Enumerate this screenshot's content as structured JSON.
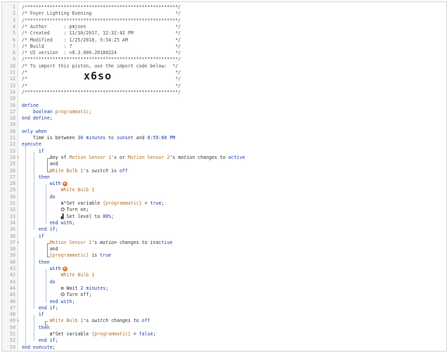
{
  "editor": {
    "import_code": "x6so",
    "lines": [
      {
        "n": "1",
        "t": [
          [
            "/*******************************************************/",
            "cm"
          ]
        ]
      },
      {
        "n": "2",
        "t": [
          [
            "/* Foyer Lighting Evening                              */",
            "cm"
          ]
        ]
      },
      {
        "n": "3",
        "t": [
          [
            "/*******************************************************/",
            "cm"
          ]
        ]
      },
      {
        "n": "4",
        "t": [
          [
            "/* Author      : pmjoen                                */",
            "cm"
          ]
        ]
      },
      {
        "n": "5",
        "t": [
          [
            "/* Created     : 11/30/2017, 12:32:42 PM               */",
            "cm"
          ]
        ]
      },
      {
        "n": "6",
        "t": [
          [
            "/* Modified    : 1/25/2018, 9:54:25 AM                 */",
            "cm"
          ]
        ]
      },
      {
        "n": "7",
        "t": [
          [
            "/* Build       : 7                                     */",
            "cm"
          ]
        ]
      },
      {
        "n": "8",
        "t": [
          [
            "/* UI version  : v0.3.000.20180224                     */",
            "cm"
          ]
        ]
      },
      {
        "n": "9",
        "t": [
          [
            "/*******************************************************/",
            "cm"
          ]
        ]
      },
      {
        "n": "10",
        "t": [
          [
            "/* To import this piston, use the import code below:  */",
            "cm"
          ]
        ]
      },
      {
        "n": "11",
        "t": [
          [
            "/*                                                     */",
            "cm"
          ]
        ]
      },
      {
        "n": "12",
        "t": [
          [
            "/*                                                     */",
            "cm"
          ]
        ]
      },
      {
        "n": "13",
        "t": [
          [
            "/*                                                     */",
            "cm"
          ]
        ]
      },
      {
        "n": "14",
        "t": [
          [
            "/*******************************************************/",
            "cm"
          ]
        ]
      },
      {
        "n": "15",
        "t": []
      },
      {
        "n": "16",
        "t": [
          [
            "define",
            "kw"
          ]
        ]
      },
      {
        "n": "17",
        "t": [
          [
            "    boolean ",
            "kw"
          ],
          [
            "programmatic",
            "var"
          ],
          [
            ";",
            ""
          ]
        ]
      },
      {
        "n": "18",
        "t": [
          [
            "end define;",
            "kw"
          ]
        ]
      },
      {
        "n": "19",
        "t": []
      },
      {
        "n": "20",
        "t": [
          [
            "only when",
            "kw"
          ]
        ]
      },
      {
        "n": "21",
        "t": [
          [
            "    Time is between ",
            ""
          ],
          [
            "30 minutes",
            "num"
          ],
          [
            " to ",
            ""
          ],
          [
            "sunset",
            "kw"
          ],
          [
            " and ",
            ""
          ],
          [
            "8:59:00 PM",
            "num"
          ]
        ]
      },
      {
        "n": "22",
        "t": [
          [
            "execute",
            "kw"
          ]
        ]
      },
      {
        "n": "23",
        "t": [
          [
            "      if",
            "kw"
          ]
        ]
      },
      {
        "n": "24",
        "t": [
          [
            "          Any of ",
            ""
          ],
          [
            "Motion Sensor 1",
            "dev"
          ],
          [
            "'s or ",
            ""
          ],
          [
            "Motion Sensor 2",
            "dev"
          ],
          [
            "'s ",
            ""
          ],
          [
            "motion",
            "it"
          ],
          [
            " changes to ",
            ""
          ],
          [
            "active",
            "kw"
          ]
        ]
      },
      {
        "n": "25",
        "t": [
          [
            "          and",
            ""
          ]
        ]
      },
      {
        "n": "26",
        "t": [
          [
            "          ",
            "",
            ""
          ],
          [
            "White Bulb 1",
            "dev"
          ],
          [
            "'s ",
            ""
          ],
          [
            "switch",
            "it"
          ],
          [
            " is ",
            ""
          ],
          [
            "off",
            "kw"
          ]
        ]
      },
      {
        "n": "27",
        "t": [
          [
            "      then",
            "kw"
          ]
        ]
      },
      {
        "n": "28",
        "t": [
          [
            "          with",
            "kw"
          ]
        ]
      },
      {
        "n": "29",
        "t": [
          [
            "              ",
            "",
            ""
          ],
          [
            "White Bulb 1",
            "dev"
          ]
        ]
      },
      {
        "n": "30",
        "t": [
          [
            "          do",
            "kw"
          ]
        ]
      },
      {
        "n": "31",
        "t": [
          [
            "              ",
            "",
            ""
          ],
          [
            "x² ",
            "ic"
          ],
          [
            "Set variable ",
            ""
          ],
          [
            "{programmatic}",
            "var"
          ],
          [
            " = ",
            ""
          ],
          [
            "true",
            "bool"
          ],
          [
            ";",
            ""
          ]
        ]
      },
      {
        "n": "32",
        "t": [
          [
            "              ",
            "",
            ""
          ],
          [
            "⏻ ",
            "ic"
          ],
          [
            "Turn on;",
            ""
          ]
        ]
      },
      {
        "n": "33",
        "t": [
          [
            "              ",
            "",
            ""
          ],
          [
            "▟ ",
            "ic"
          ],
          [
            "Set level to ",
            ""
          ],
          [
            "80%",
            "num"
          ],
          [
            ";",
            ""
          ]
        ]
      },
      {
        "n": "34",
        "t": [
          [
            "          end with;",
            "kw"
          ]
        ]
      },
      {
        "n": "35",
        "t": [
          [
            "      end if;",
            "kw"
          ]
        ]
      },
      {
        "n": "36",
        "t": [
          [
            "      if",
            "kw"
          ]
        ]
      },
      {
        "n": "37",
        "t": [
          [
            "          ",
            "",
            ""
          ],
          [
            "Motion Sensor 1",
            "dev"
          ],
          [
            "'s ",
            ""
          ],
          [
            "motion",
            "it"
          ],
          [
            " changes to ",
            ""
          ],
          [
            "inactive",
            "kw"
          ]
        ]
      },
      {
        "n": "38",
        "t": [
          [
            "          and",
            ""
          ]
        ]
      },
      {
        "n": "39",
        "t": [
          [
            "          ",
            "",
            ""
          ],
          [
            "{programmatic}",
            "var"
          ],
          [
            " is ",
            ""
          ],
          [
            "true",
            "bool"
          ]
        ]
      },
      {
        "n": "40",
        "t": [
          [
            "      then",
            "kw"
          ]
        ]
      },
      {
        "n": "41",
        "t": [
          [
            "          with",
            "kw"
          ]
        ]
      },
      {
        "n": "42",
        "t": [
          [
            "              ",
            "",
            ""
          ],
          [
            "White Bulb 1",
            "dev"
          ]
        ]
      },
      {
        "n": "43",
        "t": [
          [
            "          do",
            "kw"
          ]
        ]
      },
      {
        "n": "44",
        "t": [
          [
            "              ",
            "",
            ""
          ],
          [
            "⊙ ",
            "ic"
          ],
          [
            "Wait ",
            ""
          ],
          [
            "2 minutes",
            "num"
          ],
          [
            ";",
            ""
          ]
        ]
      },
      {
        "n": "45",
        "t": [
          [
            "              ",
            "",
            ""
          ],
          [
            "⏻ ",
            "ic"
          ],
          [
            "Turn off;",
            ""
          ]
        ]
      },
      {
        "n": "46",
        "t": [
          [
            "          end with;",
            "kw"
          ]
        ]
      },
      {
        "n": "47",
        "t": [
          [
            "      end if;",
            "kw"
          ]
        ]
      },
      {
        "n": "48",
        "t": [
          [
            "      if",
            "kw"
          ]
        ]
      },
      {
        "n": "49",
        "t": [
          [
            "          ",
            "",
            ""
          ],
          [
            "White Bulb 1",
            "dev"
          ],
          [
            "'s ",
            ""
          ],
          [
            "switch",
            "it"
          ],
          [
            " changes to ",
            ""
          ],
          [
            "off",
            "kw"
          ]
        ]
      },
      {
        "n": "50",
        "t": [
          [
            "      then",
            "kw"
          ]
        ]
      },
      {
        "n": "51",
        "t": [
          [
            "          ",
            "",
            ""
          ],
          [
            "x² ",
            "ic"
          ],
          [
            "Set variable ",
            ""
          ],
          [
            "{programmatic}",
            "var"
          ],
          [
            " = ",
            ""
          ],
          [
            "false",
            "bool"
          ],
          [
            ";",
            ""
          ]
        ]
      },
      {
        "n": "52",
        "t": [
          [
            "      end if;",
            "kw"
          ]
        ]
      },
      {
        "n": "53",
        "t": [
          [
            "end execute;",
            "kw"
          ]
        ]
      }
    ],
    "trigger_marks": [
      "24",
      "37",
      "49"
    ],
    "badge_lines": [
      "28",
      "41"
    ],
    "badge_symbol": "⚙"
  },
  "colors": {
    "keyword": "#1a3ea8",
    "device": "#b3712c",
    "trigger": "#e07b39",
    "comment": "#555555"
  }
}
